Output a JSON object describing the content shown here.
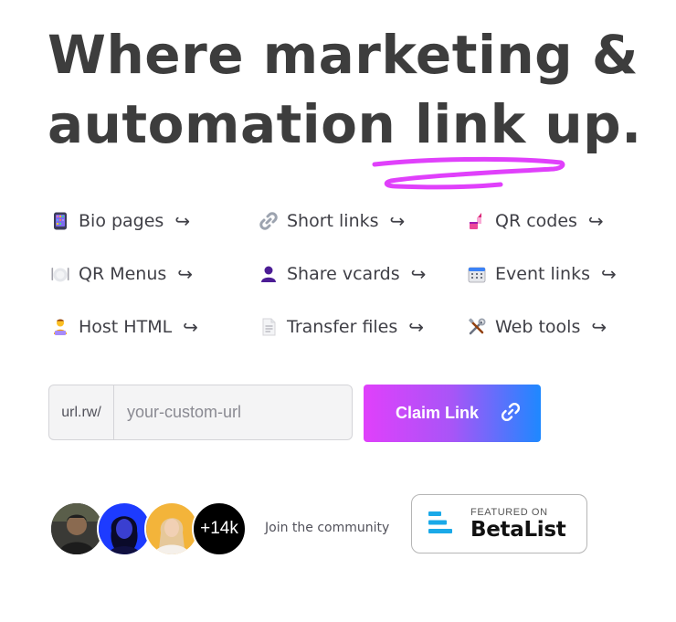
{
  "hero": {
    "line1": "Where marketing &",
    "line2": "automation link up."
  },
  "features": [
    {
      "label": "Bio pages",
      "icon": "phone-icon"
    },
    {
      "label": "Short links",
      "icon": "link-icon"
    },
    {
      "label": "QR codes",
      "icon": "lipstick-icon"
    },
    {
      "label": "QR Menus",
      "icon": "plate-icon"
    },
    {
      "label": "Share vcards",
      "icon": "person-icon"
    },
    {
      "label": "Event links",
      "icon": "calendar-icon"
    },
    {
      "label": "Host HTML",
      "icon": "technologist-icon"
    },
    {
      "label": "Transfer files",
      "icon": "document-icon"
    },
    {
      "label": "Web tools",
      "icon": "tools-icon"
    }
  ],
  "feature_arrow": "↪",
  "claim": {
    "prefix": "url.rw/",
    "placeholder": "your-custom-url",
    "value": "",
    "button_label": "Claim Link"
  },
  "community": {
    "count": "+14k",
    "text": "Join the community"
  },
  "betalist": {
    "small": "FEATURED ON",
    "big": "BetaList"
  },
  "colors": {
    "heading": "#3d3d3d",
    "accent_pink": "#e040fb",
    "accent_blue": "#1e88ff",
    "squiggle": "#e040fb",
    "betalist_blue": "#1aa9e8"
  }
}
